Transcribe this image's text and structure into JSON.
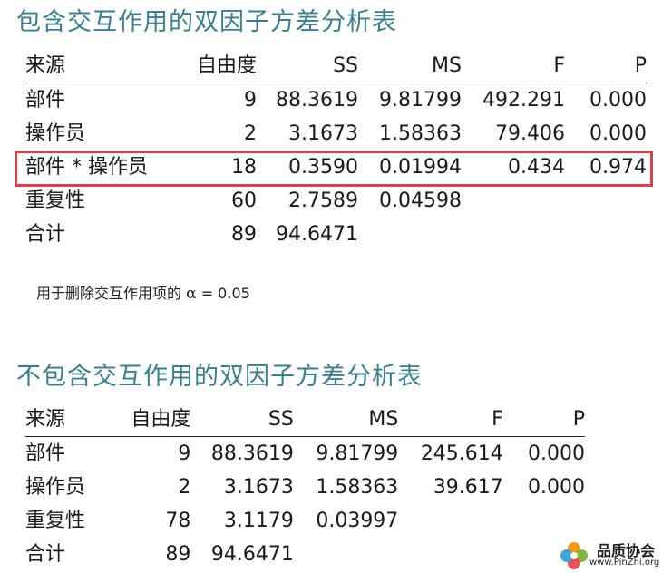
{
  "table1": {
    "title": "包含交互作用的双因子方差分析表",
    "headers": [
      "来源",
      "自由度",
      "SS",
      "MS",
      "F",
      "P"
    ],
    "rows": [
      [
        "部件",
        "9",
        "88.3619",
        "9.81799",
        "492.291",
        "0.000"
      ],
      [
        "操作员",
        "2",
        "3.1673",
        "1.58363",
        "79.406",
        "0.000"
      ],
      [
        "部件 * 操作员",
        "18",
        "0.3590",
        "0.01994",
        "0.434",
        "0.974"
      ],
      [
        "重复性",
        "60",
        "2.7589",
        "0.04598",
        "",
        ""
      ],
      [
        "合计",
        "89",
        "94.6471",
        "",
        "",
        ""
      ]
    ],
    "highlight_color": "#d9404a"
  },
  "note": {
    "prefix": "用于删除交互作用项的",
    "alpha_symbol": "α",
    "value": "= 0.05"
  },
  "table2": {
    "title": "不包含交互作用的双因子方差分析表",
    "headers": [
      "来源",
      "自由度",
      "SS",
      "MS",
      "F",
      "P"
    ],
    "rows": [
      [
        "部件",
        "9",
        "88.3619",
        "9.81799",
        "245.614",
        "0.000"
      ],
      [
        "操作员",
        "2",
        "3.1673",
        "1.58363",
        "39.617",
        "0.000"
      ],
      [
        "重复性",
        "78",
        "3.1179",
        "0.03997",
        "",
        ""
      ],
      [
        "合计",
        "89",
        "94.6471",
        "",
        "",
        ""
      ]
    ]
  },
  "watermark": {
    "name": "品质协会",
    "url": "www.PinZhi.org",
    "icon": "flower-logo-icon"
  },
  "colors": {
    "title": "#3b7f8f",
    "text": "#1a1a1a",
    "highlight": "#d9404a"
  }
}
